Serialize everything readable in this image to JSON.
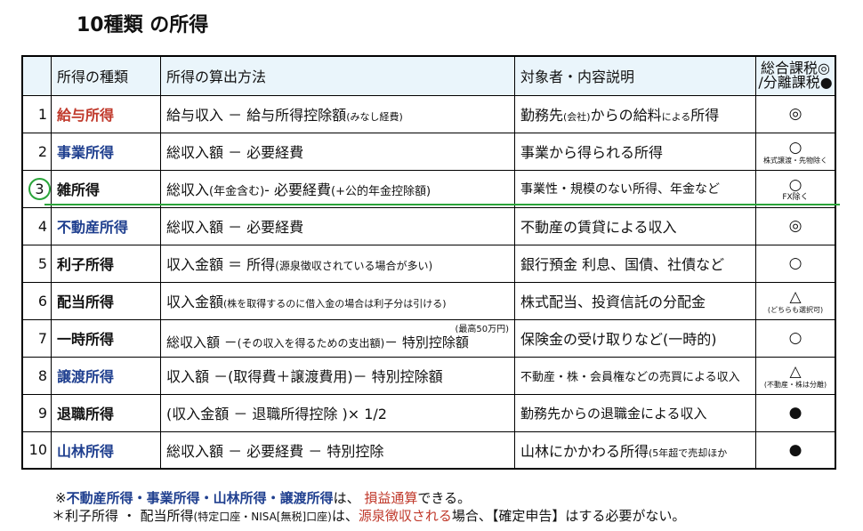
{
  "title": "10種類 の所得",
  "header": {
    "no": "",
    "type": "所得の種類",
    "calc": "所得の算出方法",
    "desc": "対象者・内容説明",
    "tax_line1": "総合課税◎",
    "tax_line2": "/分離課税●"
  },
  "rows": [
    {
      "no": "1",
      "type": "給与所得",
      "calc_main": "給与収入 － 給与所得控除額",
      "calc_small": "(みなし経費)",
      "calc_tail": "",
      "calc_sup": "",
      "desc_main": "勤務先",
      "desc_small": "(会社)",
      "desc_tail": "からの給料",
      "desc_small2": "による",
      "desc_tail2": "所得",
      "tax": "◎",
      "tax_note": ""
    },
    {
      "no": "2",
      "type": "事業所得",
      "calc_main": "総収入額 － 必要経費",
      "calc_small": "",
      "calc_tail": "",
      "calc_sup": "",
      "desc_main": "事業から得られる所得",
      "desc_small": "",
      "desc_tail": "",
      "desc_small2": "",
      "desc_tail2": "",
      "tax": "○",
      "tax_note": "株式譲渡・先物除く"
    },
    {
      "no": "3",
      "type": "雑所得",
      "calc_main": "総収入",
      "calc_small": "(年金含む)",
      "calc_tail": "- 必要経費",
      "calc_small2": "(+公的年金控除額)",
      "calc_sup": "",
      "desc_main": "事業性・規模のない所得、年金など",
      "desc_small": "",
      "desc_tail": "",
      "desc_small2": "",
      "desc_tail2": "",
      "tax": "○",
      "tax_note": "FX除く"
    },
    {
      "no": "4",
      "type": "不動産所得",
      "calc_main": "総収入額 － 必要経費",
      "calc_small": "",
      "calc_tail": "",
      "calc_sup": "",
      "desc_main": "不動産の賃貸による収入",
      "desc_small": "",
      "desc_tail": "",
      "desc_small2": "",
      "desc_tail2": "",
      "tax": "◎",
      "tax_note": ""
    },
    {
      "no": "5",
      "type": "利子所得",
      "calc_main": "収入金額 ＝ 所得",
      "calc_small": "(源泉徴収されている場合が多い)",
      "calc_tail": "",
      "calc_sup": "",
      "desc_main": "銀行預金 利息、国債、社債など",
      "desc_small": "",
      "desc_tail": "",
      "desc_small2": "",
      "desc_tail2": "",
      "tax": "○",
      "tax_note": ""
    },
    {
      "no": "6",
      "type": "配当所得",
      "calc_main": "収入金額",
      "calc_small": "(株を取得するのに借入金の場合は利子分は引ける)",
      "calc_tail": "",
      "calc_sup": "",
      "desc_main": "株式配当、投資信託の分配金",
      "desc_small": "",
      "desc_tail": "",
      "desc_small2": "",
      "desc_tail2": "",
      "tax": "△",
      "tax_note": "(どちらも選択可)"
    },
    {
      "no": "7",
      "type": "一時所得",
      "calc_main": "総収入額 －",
      "calc_small": "(その収入を得るための支出額)",
      "calc_tail": "－ 特別控除額",
      "calc_sup": "(最高50万円)",
      "desc_main": "保険金の受け取りなど(一時的)",
      "desc_small": "",
      "desc_tail": "",
      "desc_small2": "",
      "desc_tail2": "",
      "tax": "○",
      "tax_note": ""
    },
    {
      "no": "8",
      "type": "譲渡所得",
      "calc_main": "収入額 －(取得費＋譲渡費用)－ 特別控除額",
      "calc_small": "",
      "calc_tail": "",
      "calc_sup": "",
      "desc_main": "不動産・株・会員権などの売買による収入",
      "desc_small": "",
      "desc_tail": "",
      "desc_small2": "",
      "desc_tail2": "",
      "tax": "△",
      "tax_note": "(不動産・株は分離)"
    },
    {
      "no": "9",
      "type": "退職所得",
      "calc_main": "(収入金額 － 退職所得控除 )× 1/2",
      "calc_small": "",
      "calc_tail": "",
      "calc_sup": "",
      "desc_main": "勤務先からの退職金による収入",
      "desc_small": "",
      "desc_tail": "",
      "desc_small2": "",
      "desc_tail2": "",
      "tax": "●",
      "tax_note": ""
    },
    {
      "no": "10",
      "type": "山林所得",
      "calc_main": "総収入額 － 必要経費 － 特別控除",
      "calc_small": "",
      "calc_tail": "",
      "calc_sup": "",
      "desc_main": "山林にかかわる所得",
      "desc_small": "(5年超で売却ほか",
      "desc_tail": "",
      "desc_small2": "",
      "desc_tail2": "",
      "tax": "●",
      "tax_note": ""
    }
  ],
  "notes": {
    "n1_prefix": "※",
    "n1_items": "不動産所得・事業所得・山林所得・譲渡所得",
    "n1_mid": "は、",
    "n1_red": "損益通算",
    "n1_tail": "できる。",
    "n2_a": "＊利子所得 ・ 配当所得",
    "n2_small": "(特定口座・NISA[無税]口座)",
    "n2_b": "は、",
    "n2_red": "源泉徴収される",
    "n2_c": "場合、【確定申告】はする必要がない。"
  },
  "colors": {
    "red": "#c0392b",
    "blue": "#1f3f8f",
    "green": "#2aa43a",
    "header_bg": "#eaf5fb"
  }
}
